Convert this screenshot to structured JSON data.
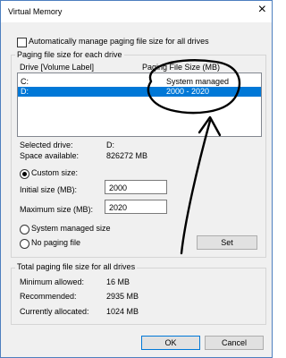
{
  "window": {
    "title": "Virtual Memory",
    "top_strip_text": "… … … … … … … … … … … …"
  },
  "auto_manage": {
    "label": "Automatically manage paging file size for all drives",
    "checked": false
  },
  "paging_group": {
    "legend": "Paging file size for each drive",
    "col_drive": "Drive  [Volume Label]",
    "col_size": "Paging File Size (MB)",
    "drives": [
      {
        "drive": "C:",
        "size": "System managed",
        "selected": false
      },
      {
        "drive": "D:",
        "size": "2000 - 2020",
        "selected": true
      }
    ],
    "selected_drive_label": "Selected drive:",
    "selected_drive_value": "D:",
    "space_available_label": "Space available:",
    "space_available_value": "826272 MB",
    "custom_size_label": "Custom size:",
    "initial_size_label": "Initial size (MB):",
    "initial_size_value": "2000",
    "maximum_size_label": "Maximum size (MB):",
    "maximum_size_value": "2020",
    "system_managed_label": "System managed size",
    "no_paging_label": "No paging file",
    "set_button": "Set",
    "selected_option": "custom"
  },
  "total_group": {
    "legend": "Total paging file size for all drives",
    "minimum_label": "Minimum allowed:",
    "minimum_value": "16 MB",
    "recommended_label": "Recommended:",
    "recommended_value": "2935 MB",
    "allocated_label": "Currently allocated:",
    "allocated_value": "1024 MB"
  },
  "buttons": {
    "ok": "OK",
    "cancel": "Cancel"
  },
  "colors": {
    "selection": "#0078d7",
    "annotation_ink": "#000000"
  }
}
